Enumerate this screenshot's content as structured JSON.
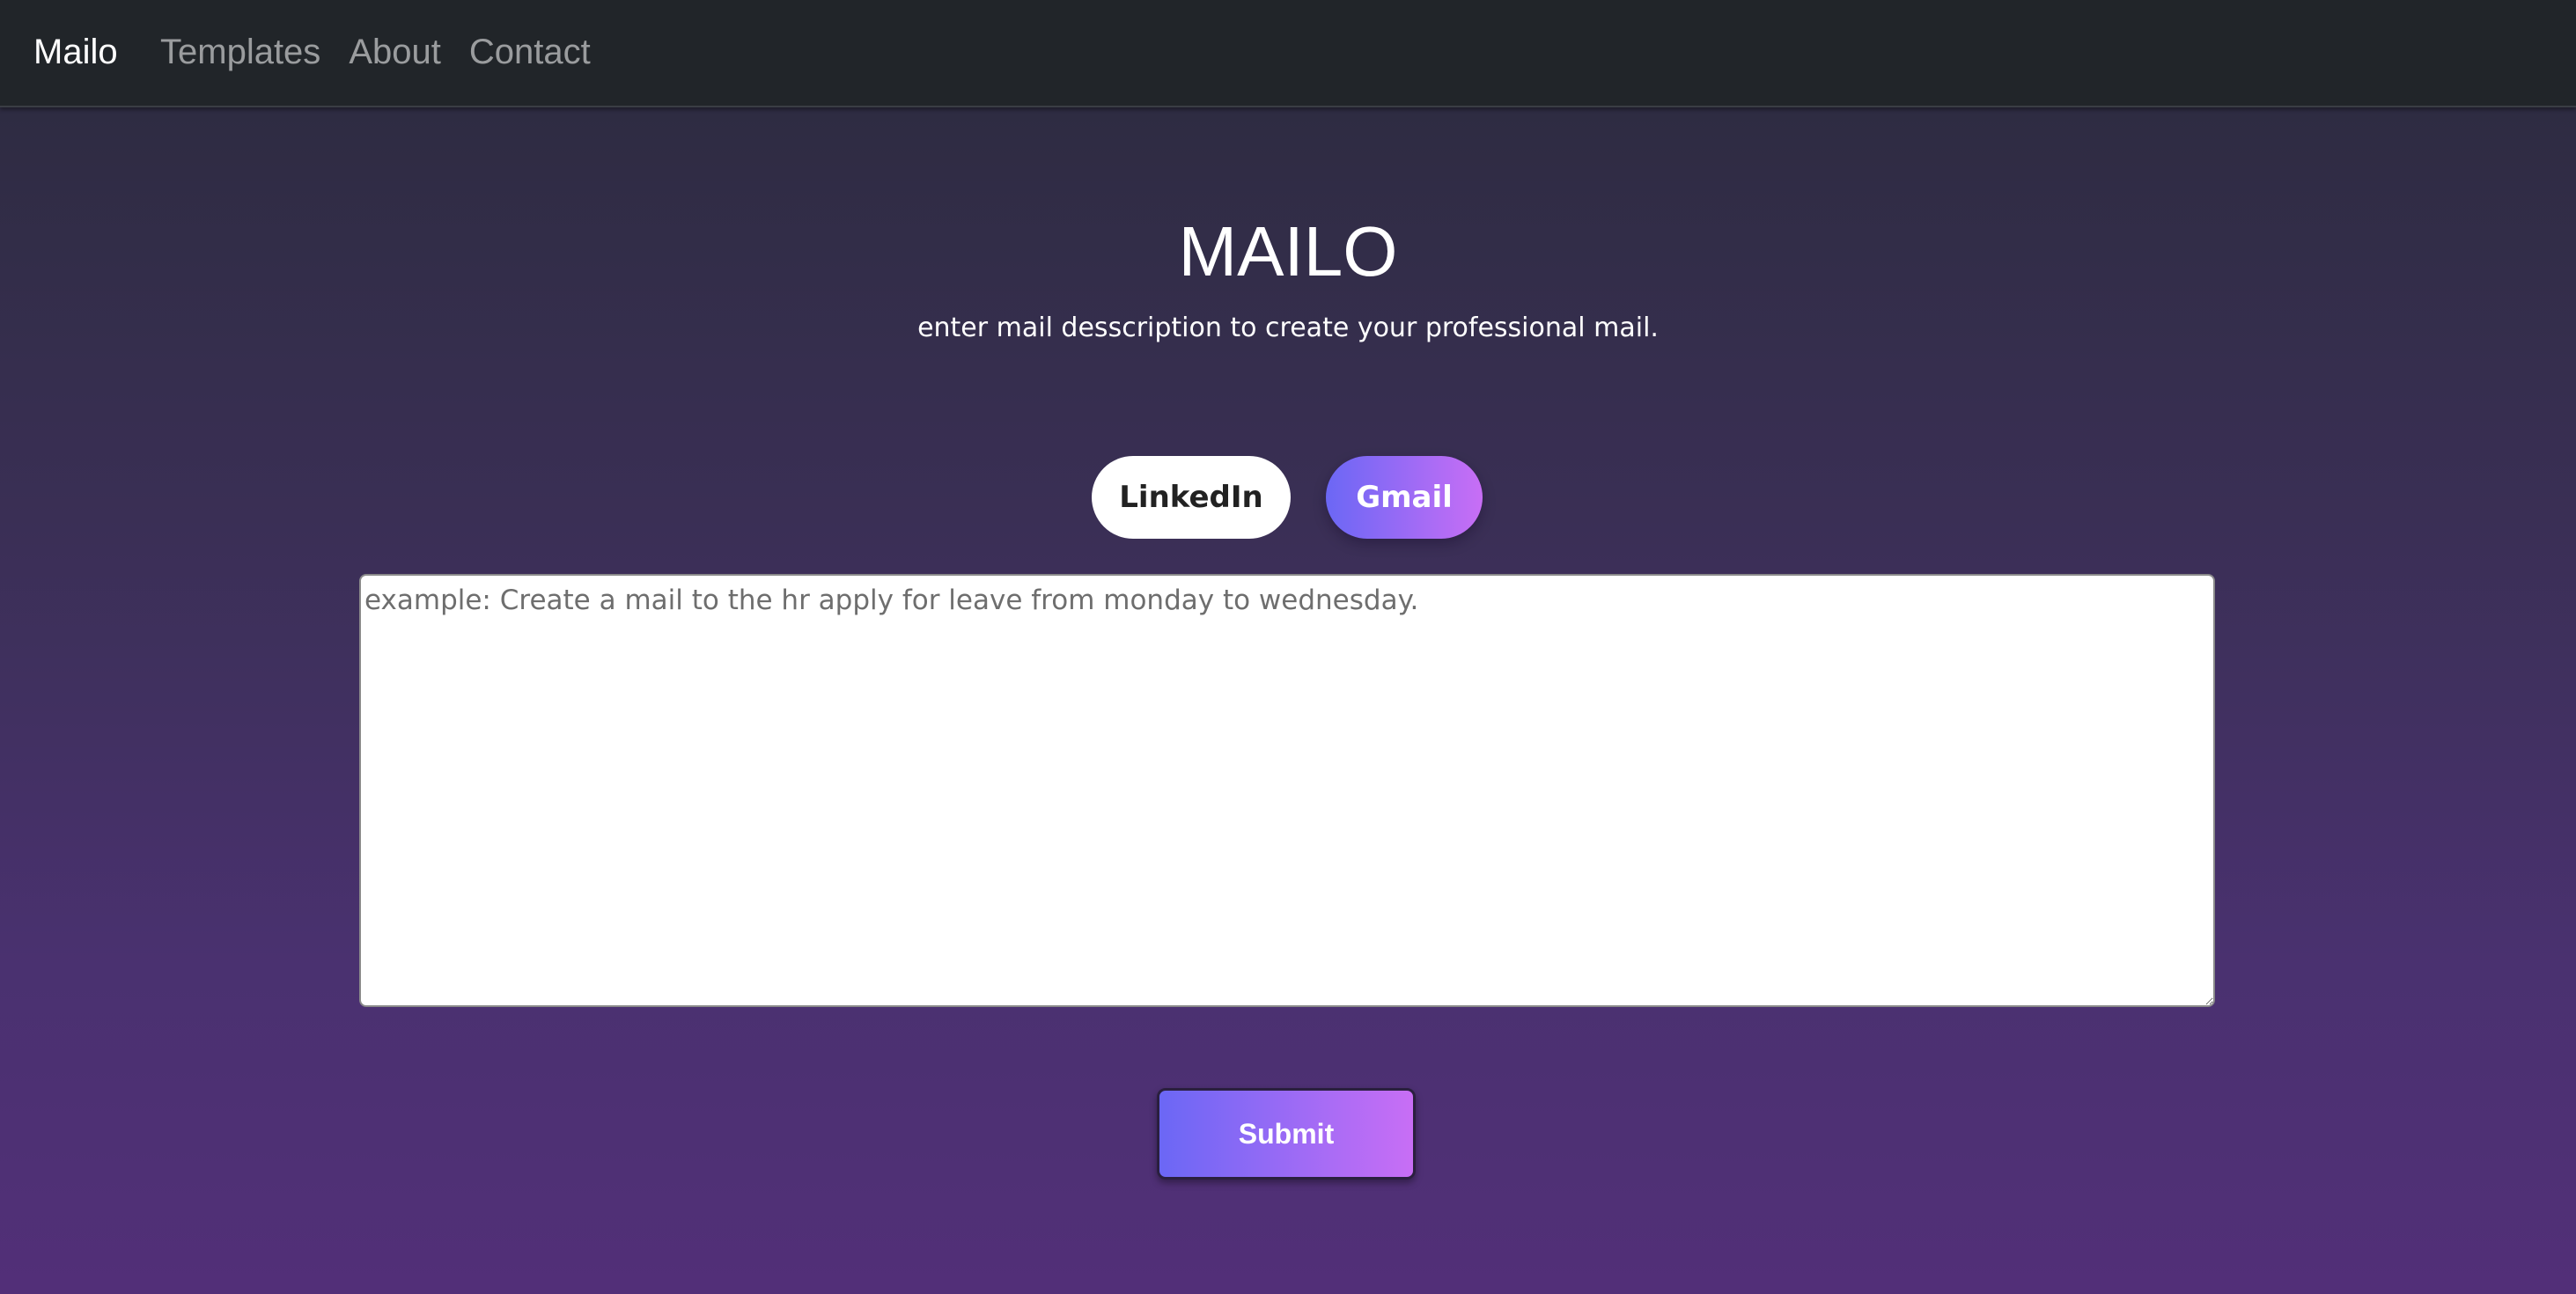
{
  "navbar": {
    "brand": "Mailo",
    "links": [
      {
        "label": "Templates"
      },
      {
        "label": "About"
      },
      {
        "label": "Contact"
      }
    ]
  },
  "hero": {
    "title": "MAILO",
    "subtitle": "enter mail desscription to create your professional mail."
  },
  "platforms": {
    "options": [
      {
        "label": "LinkedIn",
        "selected": false
      },
      {
        "label": "Gmail",
        "selected": true
      }
    ]
  },
  "composer": {
    "value": "",
    "placeholder": "example: Create a mail to the hr apply for leave from monday to wednesday."
  },
  "actions": {
    "submit_label": "Submit"
  },
  "colors": {
    "navbar_bg": "#212529",
    "gradient_start": "#6b67f5",
    "gradient_end": "#c86ef5",
    "page_bg_top": "#2b2b3d",
    "page_bg_bottom": "#522f78"
  }
}
